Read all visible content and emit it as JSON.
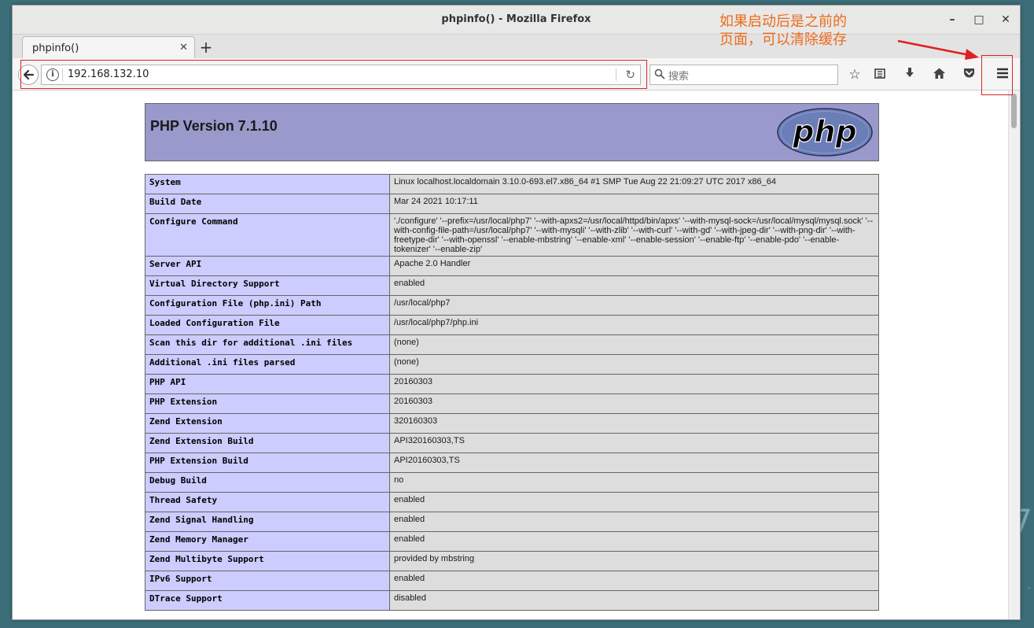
{
  "window": {
    "title": "phpinfo() - Mozilla Firefox",
    "minimize": "–",
    "maximize": "□",
    "close": "✕"
  },
  "tab": {
    "title": "phpinfo()",
    "close": "✕",
    "new_tab": "+"
  },
  "nav": {
    "url": "192.168.132.10",
    "search_placeholder": "搜索"
  },
  "annotation": {
    "line1": "如果启动后是之前的",
    "line2": "页面，可以清除缓存",
    "color": "#ee6a1a"
  },
  "php": {
    "version_title": "PHP Version 7.1.10",
    "logo_text": "php",
    "rows": [
      {
        "key": "System",
        "value": "Linux localhost.localdomain 3.10.0-693.el7.x86_64 #1 SMP Tue Aug 22 21:09:27 UTC 2017 x86_64"
      },
      {
        "key": "Build Date",
        "value": "Mar 24 2021 10:17:11"
      },
      {
        "key": "Configure Command",
        "value": "'./configure' '--prefix=/usr/local/php7' '--with-apxs2=/usr/local/httpd/bin/apxs' '--with-mysql-sock=/usr/local/mysql/mysql.sock' '--with-config-file-path=/usr/local/php7' '--with-mysqli' '--with-zlib' '--with-curl' '--with-gd' '--with-jpeg-dir' '--with-png-dir' '--with-freetype-dir' '--with-openssl' '--enable-mbstring' '--enable-xml' '--enable-session' '--enable-ftp' '--enable-pdo' '--enable-tokenizer' '--enable-zip'"
      },
      {
        "key": "Server API",
        "value": "Apache 2.0 Handler"
      },
      {
        "key": "Virtual Directory Support",
        "value": "enabled"
      },
      {
        "key": "Configuration File (php.ini) Path",
        "value": "/usr/local/php7"
      },
      {
        "key": "Loaded Configuration File",
        "value": "/usr/local/php7/php.ini"
      },
      {
        "key": "Scan this dir for additional .ini files",
        "value": "(none)"
      },
      {
        "key": "Additional .ini files parsed",
        "value": "(none)"
      },
      {
        "key": "PHP API",
        "value": "20160303"
      },
      {
        "key": "PHP Extension",
        "value": "20160303"
      },
      {
        "key": "Zend Extension",
        "value": "320160303"
      },
      {
        "key": "Zend Extension Build",
        "value": "API320160303,TS"
      },
      {
        "key": "PHP Extension Build",
        "value": "API20160303,TS"
      },
      {
        "key": "Debug Build",
        "value": "no"
      },
      {
        "key": "Thread Safety",
        "value": "enabled"
      },
      {
        "key": "Zend Signal Handling",
        "value": "enabled"
      },
      {
        "key": "Zend Memory Manager",
        "value": "enabled"
      },
      {
        "key": "Zend Multibyte Support",
        "value": "provided by mbstring"
      },
      {
        "key": "IPv6 Support",
        "value": "enabled"
      },
      {
        "key": "DTrace Support",
        "value": "disabled"
      }
    ]
  },
  "colors": {
    "header_bg": "#9999cc",
    "key_bg": "#ccccff",
    "value_bg": "#dddddd",
    "highlight": "#e02020"
  }
}
